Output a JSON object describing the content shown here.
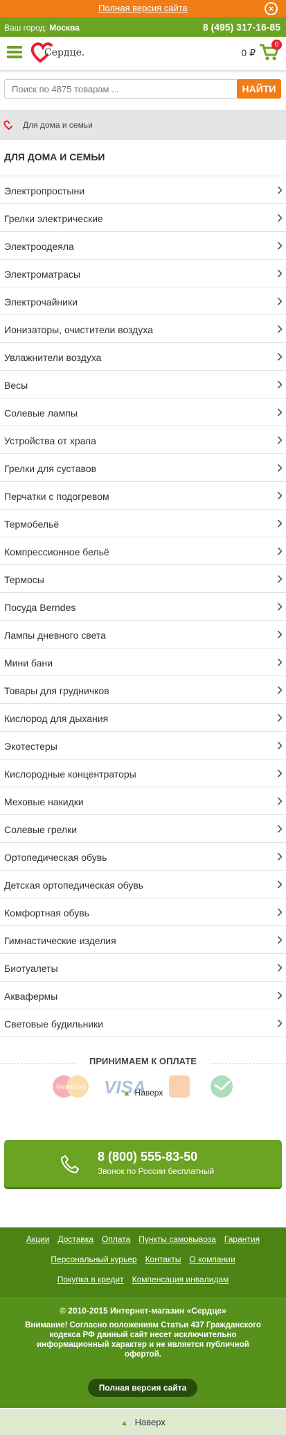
{
  "topbar": {
    "full_site_link": "Полная версия сайта",
    "close_icon": "close-icon"
  },
  "citybar": {
    "city_label": "Ваш город:",
    "city": "Москва",
    "phone": "8 (495) 317-16-85"
  },
  "header": {
    "logo_text": "Сердце.",
    "cart_sum": "0 ₽",
    "cart_count": "0"
  },
  "search": {
    "placeholder": "Поиск по 4875 товарам ...",
    "button": "НАЙТИ"
  },
  "breadcrumb": {
    "item": "Для дома и семьи"
  },
  "page_title": "ДЛЯ ДОМА И СЕМЬИ",
  "categories": [
    "Электропростыни",
    "Грелки электрические",
    "Электроодеяла",
    "Электроматрасы",
    "Электрочайники",
    "Ионизаторы, очистители воздуха",
    "Увлажнители воздуха",
    "Весы",
    "Солевые лампы",
    "Устройства от храпа",
    "Грелки для суставов",
    "Перчатки с подогревом",
    "Термобельё",
    "Компрессионное бельё",
    "Термосы",
    "Посуда Berndes",
    "Лампы дневного света",
    "Мини бани",
    "Товары для грудничков",
    "Кислород для дыхания",
    "Экотестеры",
    "Кислородные концентраторы",
    "Меховые накидки",
    "Солевые грелки",
    "Ортопедическая обувь",
    "Детская ортопедическая обувь",
    "Комфортная обувь",
    "Гимнастические изделия",
    "Биотуалеты",
    "Аквафермы",
    "Световые будильники"
  ],
  "payment": {
    "title": "ПРИНИМАЕМ К ОПЛАТЕ",
    "mastercard": "MasterCard",
    "visa": "VISA",
    "up_label": "Наверх"
  },
  "phone_block": {
    "number": "8 (800) 555-83-50",
    "sub": "Звонок по России бесплатный"
  },
  "footer": {
    "nav_row1": [
      "Акции",
      "Доставка",
      "Оплата",
      "Пункты самовывоза",
      "Гарантия"
    ],
    "nav_row2": [
      "Персональный курьер",
      "Контакты",
      "О компании"
    ],
    "nav_row3": [
      "Покупка в кредит",
      "Компенсация инвалидам"
    ],
    "copyright": "© 2010-2015 Интернет-магазин «Сердце»",
    "notice": "Внимание! Согласно положениям Статьи 437 Гражданского кодекса РФ данный сайт несет исключительно информационный характер и не является публичной офертой.",
    "full_site_button": "Полная версия сайта"
  },
  "bottom": {
    "up_label": "Наверх"
  },
  "colors": {
    "green": "#6ba323",
    "orange": "#f07d16",
    "dark_green": "#264d0c",
    "badge_red": "#e5202e"
  }
}
